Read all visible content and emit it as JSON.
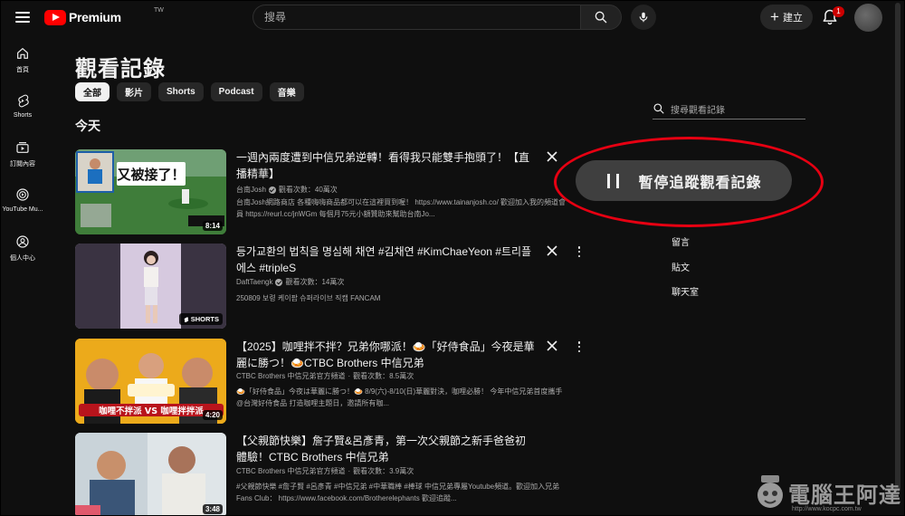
{
  "header": {
    "logo_text": "Premium",
    "logo_region": "TW",
    "search_placeholder": "搜尋",
    "create_label": "建立",
    "notification_count": "1"
  },
  "sidebar": {
    "items": [
      {
        "label": "首頁",
        "icon": "home-icon"
      },
      {
        "label": "Shorts",
        "icon": "shorts-icon"
      },
      {
        "label": "訂閱內容",
        "icon": "subscriptions-icon"
      },
      {
        "label": "YouTube Mu...",
        "icon": "youtube-music-icon"
      },
      {
        "label": "個人中心",
        "icon": "person-icon"
      }
    ]
  },
  "page": {
    "title": "觀看記錄",
    "chips": [
      "全部",
      "影片",
      "Shorts",
      "Podcast",
      "音樂"
    ],
    "section": "今天"
  },
  "videos": [
    {
      "title": "一週內兩度遭到中信兄弟逆轉！看得我只能雙手抱頭了！【直播精華】",
      "channel": "台南Josh",
      "views": "觀看次數：40萬次",
      "desc": "台南Josh網路商店 各種嗨嗨商品都可以在這裡買到喔！ https://www.tainanjosh.co/ 歡迎加入我的頻道會員 https://reurl.cc/jnWGm 每個月75元小額贊助來幫助台南Jo...",
      "duration": "8:14",
      "thumb_caption": "又被接了！",
      "thumb_colors": [
        "#3c7a3a",
        "#6aa84f"
      ]
    },
    {
      "title": "등가교환의 법칙을 명심해 채연 #김채연 #KimChaeYeon #트리플에스 #tripleS",
      "channel": "DaftTaengk",
      "views": "觀看次數：14萬次",
      "desc": "250809 보령 케이팝 슈퍼라이브 직캠 FANCAM",
      "duration": "SHORTS",
      "thumb_colors": [
        "#b7a3c7",
        "#d9cde3"
      ]
    },
    {
      "title": "【2025】咖哩拌不拌？兄弟你哪派！🍛「好侍食品」今夜是華麗に勝つ！🍛CTBC Brothers 中信兄弟",
      "channel": "CTBC Brothers 中信兄弟官方頻道",
      "views": "觀看次數：8.5萬次",
      "desc": "🍛「好侍食品」今夜は華麗に勝つ！🍛 8/9(六)-8/10(日)華麗對決，咖哩必勝！ 今年中信兄弟首度攜手 @台灣好侍食品 打造咖哩主題日，邀請所有咖...",
      "duration": "4:20",
      "thumb_caption": "咖哩不拌派 VS 咖哩拌拌派",
      "thumb_colors": [
        "#f2b21d",
        "#f7d36a"
      ]
    },
    {
      "title": "【父親節快樂】詹子賢&呂彥青，第一次父親節之新手爸爸初體驗！CTBC Brothers 中信兄弟",
      "channel": "CTBC Brothers 中信兄弟官方頻道",
      "views": "觀看次數：3.9萬次",
      "desc": "#父親節快樂 #詹子賢 #呂彥青 #中信兄弟 #中華職棒 #棒球 中信兄弟專屬Youtube頻道。歡迎加入兄弟Fans Club： https://www.facebook.com/Brotherelephants 歡迎追蹤...",
      "duration": "3:48",
      "thumb_colors": [
        "#cfd8de",
        "#eef1f3"
      ]
    }
  ],
  "right_panel": {
    "search_placeholder": "搜尋觀看記錄",
    "pause_label": "暫停追蹤觀看記錄",
    "links": [
      "留言",
      "貼文",
      "聊天室"
    ]
  },
  "watermark": {
    "text": "電腦王阿達",
    "url": "http://www.kocpc.com.tw"
  },
  "colors": {
    "background": "#0f0f0f",
    "brand_red": "#ff0000",
    "highlight_red": "#e60012"
  }
}
